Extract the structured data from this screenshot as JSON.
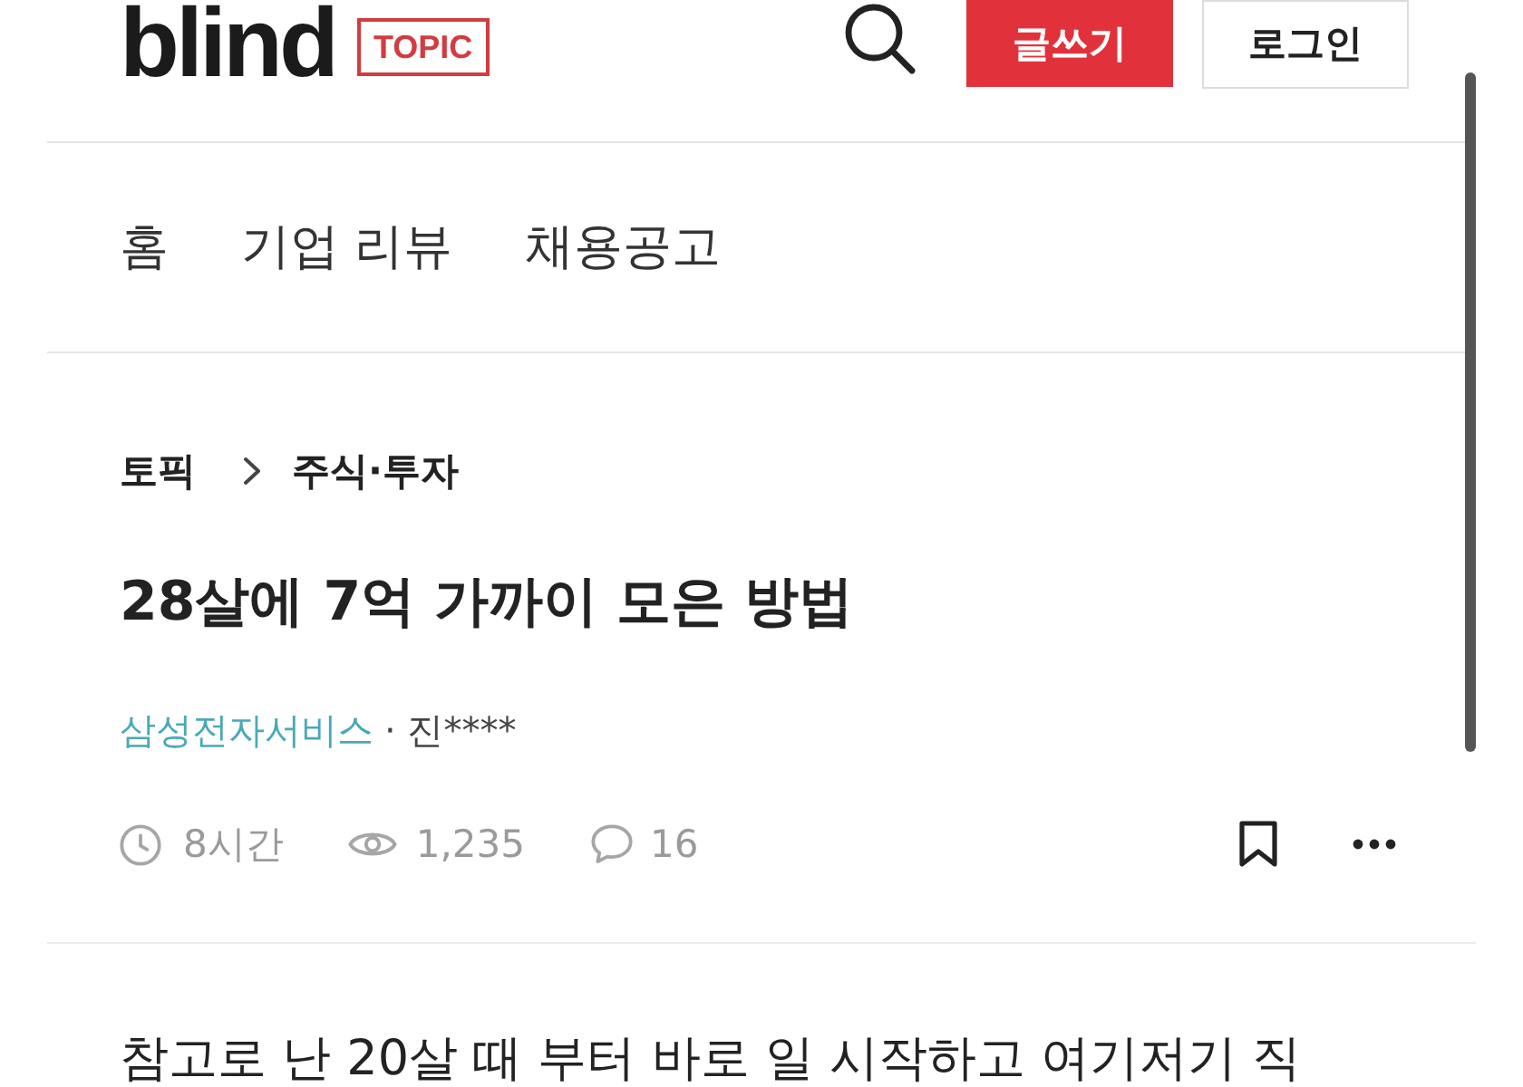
{
  "header": {
    "logo": "blind",
    "badge": "TOPIC",
    "buttons": [
      {
        "label": "글쓰기",
        "kind": "primary"
      },
      {
        "label": "로그인",
        "kind": "secondary"
      }
    ]
  },
  "nav": {
    "items": [
      "홈",
      "기업 리뷰",
      "채용공고"
    ]
  },
  "breadcrumb": [
    "토픽",
    "주식·투자"
  ],
  "post": {
    "title": "28살에 7억 가까이 모은 방법",
    "company": "삼성전자서비스",
    "author": "· 진****",
    "stats": [
      {
        "kind": "time",
        "text": "8시간"
      },
      {
        "kind": "views",
        "text": "1,235"
      },
      {
        "kind": "comments",
        "text": "16"
      }
    ],
    "body": "참고로 난 20살 때 부터 바로 일 시작하고 여기저기 직"
  }
}
